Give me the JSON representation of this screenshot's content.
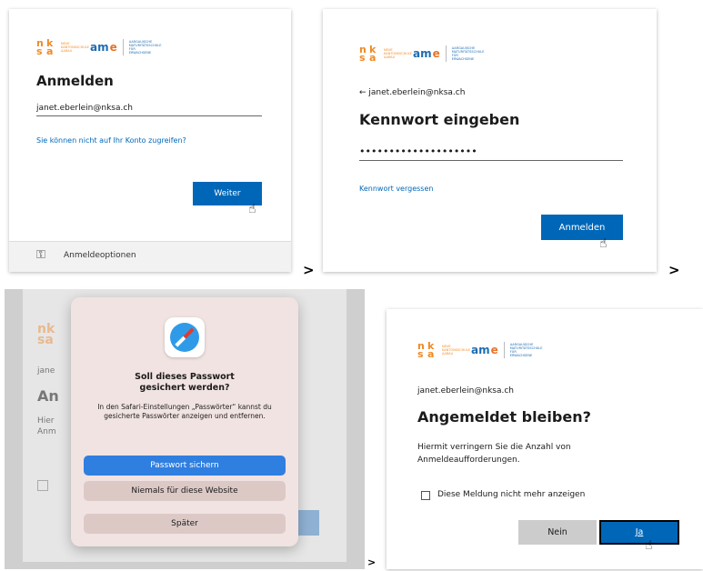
{
  "panel1": {
    "title": "Anmelden",
    "email_value": "janet.eberlein@nksa.ch",
    "link": "Sie können nicht auf Ihr Konto zugreifen?",
    "button": "Weiter",
    "options_label": "Anmeldeoptionen",
    "logo": {
      "nksa": [
        "n",
        "k",
        "s",
        "a"
      ],
      "school_lines": "NEUE KANTONSSCHULE AARAU",
      "ame": "am",
      "ame_e": "e",
      "ame_lines": "AARGAUISCHE MATURITÄTSSCHULE FÜR ERWACHSENE"
    }
  },
  "panel2": {
    "back_email": "← janet.eberlein@nksa.ch",
    "title": "Kennwort eingeben",
    "password_mask": "••••••••••••••••••••",
    "link": "Kennwort vergessen",
    "button": "Anmelden"
  },
  "separators": {
    "s1": ">",
    "s2": ">",
    "s3": ">"
  },
  "panel3": {
    "bg_text": {
      "logo": "nk sa",
      "email": "jane",
      "heading": "An",
      "line1": "Hier",
      "line2": "Anm"
    },
    "dialog": {
      "title": "Soll dieses Passwort gesichert werden?",
      "body": "In den Safari-Einstellungen „Passwörter“ kannst du gesicherte Passwörter anzeigen und entfernen.",
      "btn_save": "Passwort sichern",
      "btn_never": "Niemals für diese Website",
      "btn_later": "Später"
    }
  },
  "panel4": {
    "email": "janet.eberlein@nksa.ch",
    "title": "Angemeldet bleiben?",
    "body": "Hiermit verringern Sie die Anzahl von Anmeldeaufforderungen.",
    "checkbox_label": "Diese Meldung nicht mehr anzeigen",
    "btn_no": "Nein",
    "btn_yes": "Ja"
  },
  "colors": {
    "accent": "#0067b8",
    "dialog_bg": "#f1e3e1",
    "blue_button": "#2f7fe0",
    "dim_bg": "#cfcfcf"
  }
}
